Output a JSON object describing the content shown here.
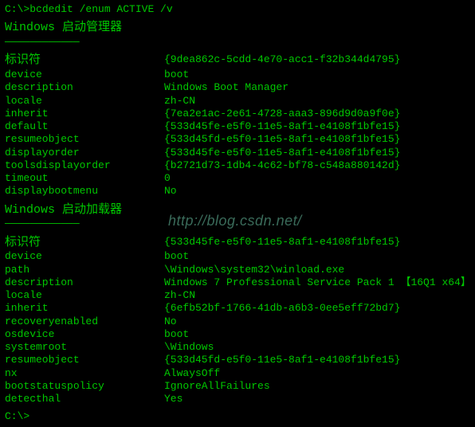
{
  "prompt": "C:\\>",
  "command": "bcdedit /enum ACTIVE /v",
  "watermark": "http://blog.csdn.net/",
  "manager": {
    "heading": "Windows 启动管理器",
    "underline": "————————————",
    "id_label": "标识符",
    "id_value": "{9dea862c-5cdd-4e70-acc1-f32b344d4795}",
    "rows": [
      {
        "k": "device",
        "v": "boot"
      },
      {
        "k": "description",
        "v": "Windows Boot Manager"
      },
      {
        "k": "locale",
        "v": "zh-CN"
      },
      {
        "k": "inherit",
        "v": "{7ea2e1ac-2e61-4728-aaa3-896d9d0a9f0e}"
      },
      {
        "k": "default",
        "v": "{533d45fe-e5f0-11e5-8af1-e4108f1bfe15}"
      },
      {
        "k": "resumeobject",
        "v": "{533d45fd-e5f0-11e5-8af1-e4108f1bfe15}"
      },
      {
        "k": "displayorder",
        "v": "{533d45fe-e5f0-11e5-8af1-e4108f1bfe15}"
      },
      {
        "k": "toolsdisplayorder",
        "v": "{b2721d73-1db4-4c62-bf78-c548a880142d}"
      },
      {
        "k": "timeout",
        "v": "0"
      },
      {
        "k": "displaybootmenu",
        "v": "No"
      }
    ]
  },
  "loader": {
    "heading": "Windows 启动加载器",
    "underline": "————————————",
    "id_label": "标识符",
    "id_value": "{533d45fe-e5f0-11e5-8af1-e4108f1bfe15}",
    "rows": [
      {
        "k": "device",
        "v": "boot"
      },
      {
        "k": "path",
        "v": "\\Windows\\system32\\winload.exe"
      },
      {
        "k": "description",
        "v": "Windows 7 Professional Service Pack 1 【16Q1 x64】"
      },
      {
        "k": "locale",
        "v": "zh-CN"
      },
      {
        "k": "inherit",
        "v": "{6efb52bf-1766-41db-a6b3-0ee5eff72bd7}"
      },
      {
        "k": "recoveryenabled",
        "v": "No"
      },
      {
        "k": "osdevice",
        "v": "boot"
      },
      {
        "k": "systemroot",
        "v": "\\Windows"
      },
      {
        "k": "resumeobject",
        "v": "{533d45fd-e5f0-11e5-8af1-e4108f1bfe15}"
      },
      {
        "k": "nx",
        "v": "AlwaysOff"
      },
      {
        "k": "bootstatuspolicy",
        "v": "IgnoreAllFailures"
      },
      {
        "k": "detecthal",
        "v": "Yes"
      }
    ]
  },
  "end_prompt": "C:\\>"
}
